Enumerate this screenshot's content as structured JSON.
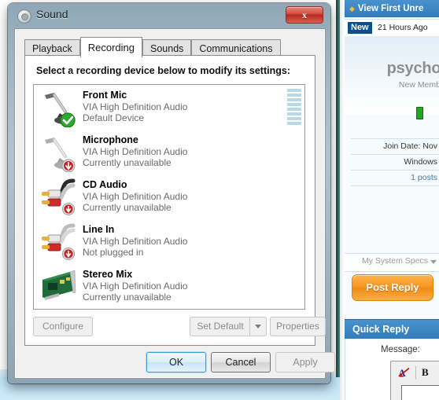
{
  "window": {
    "title": "Sound",
    "icon": "speaker-icon",
    "close_label": "x"
  },
  "tabs": [
    {
      "label": "Playback",
      "selected": false
    },
    {
      "label": "Recording",
      "selected": true
    },
    {
      "label": "Sounds",
      "selected": false
    },
    {
      "label": "Communications",
      "selected": false
    }
  ],
  "panel": {
    "instruction": "Select a recording device below to modify its settings:",
    "devices": [
      {
        "name": "Front Mic",
        "driver": "VIA High Definition Audio",
        "status": "Default Device",
        "icon": "microphone-icon",
        "badge": "green-check-badge",
        "has_meter": true
      },
      {
        "name": "Microphone",
        "driver": "VIA High Definition Audio",
        "status": "Currently unavailable",
        "icon": "microphone-icon",
        "badge": "red-down-arrow-badge",
        "has_meter": false
      },
      {
        "name": "CD Audio",
        "driver": "VIA High Definition Audio",
        "status": "Currently unavailable",
        "icon": "rca-cable-icon",
        "badge": "red-down-arrow-badge",
        "has_meter": false
      },
      {
        "name": "Line In",
        "driver": "VIA High Definition Audio",
        "status": "Not plugged in",
        "icon": "rca-cable-icon",
        "badge": "red-down-arrow-badge",
        "has_meter": false
      },
      {
        "name": "Stereo Mix",
        "driver": "VIA High Definition Audio",
        "status": "Currently unavailable",
        "icon": "sound-card-icon",
        "badge": "",
        "has_meter": false
      }
    ],
    "buttons": {
      "configure": "Configure",
      "set_default": "Set Default",
      "properties": "Properties"
    },
    "meter_segments": 8
  },
  "dialog_buttons": {
    "ok": "OK",
    "cancel": "Cancel",
    "apply": "Apply"
  },
  "webpage": {
    "view_first_unread": "View First Unre",
    "new_badge": "New",
    "post_time": "21 Hours Ago",
    "username": "psychor",
    "member_rank": "New Memb",
    "info_rows": [
      "Join Date: Nov",
      "Windows",
      "1 posts"
    ],
    "system_specs": "My System Specs",
    "post_reply": "Post Reply",
    "quick_reply_title": "Quick Reply",
    "message_label": "Message:",
    "toolbar_bold": "B"
  },
  "colors": {
    "accent_blue": "#2f7cbb",
    "badge_blue": "#0d4f8b",
    "orange_button": "#f79422",
    "green_status": "#2aa32a",
    "meter_segment": "#b9d9e4",
    "close_red": "#b82a1d",
    "link_blue": "#3a78b5"
  }
}
